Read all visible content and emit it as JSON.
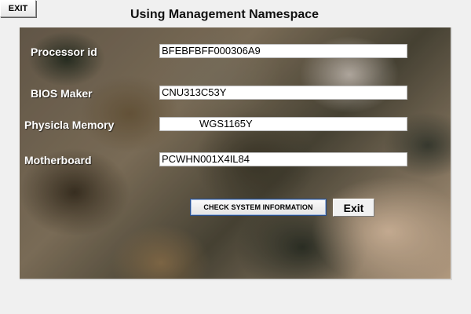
{
  "top_exit_label": "EXIT",
  "title": "Using Management Namespace",
  "fields": [
    {
      "label": "Processor id",
      "value": "BFEBFBFF000306A9"
    },
    {
      "label": "BIOS Maker",
      "value": "CNU313C53Y"
    },
    {
      "label": "Physicla Memory",
      "value": "WGS1165Y"
    },
    {
      "label": "Motherboard",
      "value": "PCWHN001X4IL84"
    }
  ],
  "buttons": {
    "check_label": "CHECK SYSTEM INFORMATION",
    "exit_label": "Exit"
  }
}
